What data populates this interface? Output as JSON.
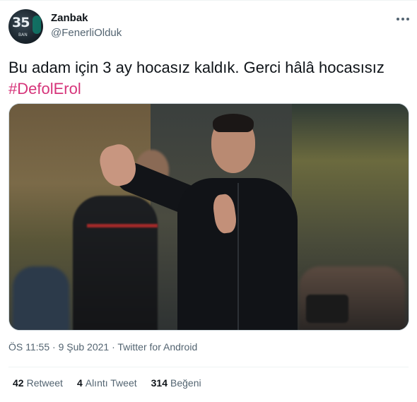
{
  "author": {
    "name": "Zanbak",
    "handle": "@FenerliOlduk",
    "avatar_number": "35",
    "avatar_caption": "BAN"
  },
  "tweet": {
    "text": "Bu adam için 3 ay hocasız kaldık. Gerci hâlâ hocasısız",
    "hashtag": "#DefolErol"
  },
  "meta": {
    "time": "ÖS 11:55",
    "separator": "·",
    "date": "9 Şub 2021",
    "source": "Twitter for Android"
  },
  "stats": [
    {
      "count": "42",
      "label": "Retweet"
    },
    {
      "count": "4",
      "label": "Alıntı Tweet"
    },
    {
      "count": "314",
      "label": "Beğeni"
    }
  ],
  "icons": {
    "more": "more-dots-icon"
  },
  "colors": {
    "hashtag": "#d6347a",
    "secondary_text": "#536471",
    "primary_text": "#0f1419"
  }
}
